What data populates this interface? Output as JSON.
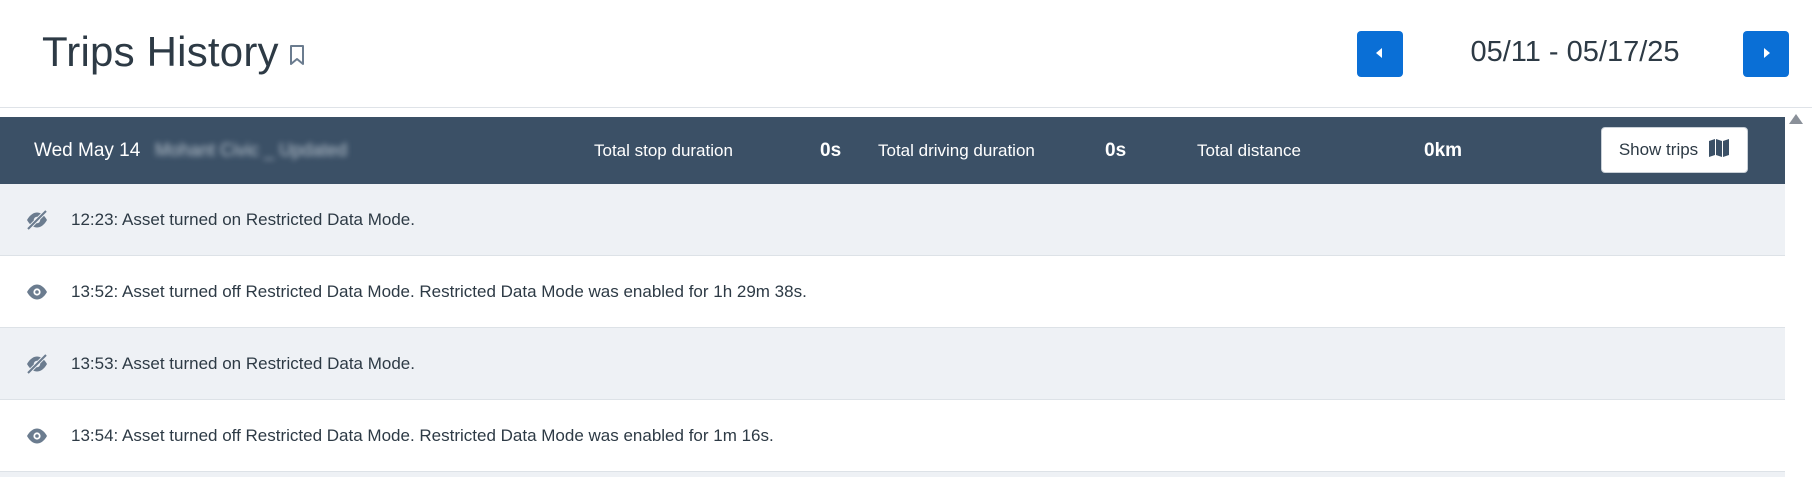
{
  "header": {
    "title": "Trips History",
    "date_range": "05/11 - 05/17/25",
    "icons": {
      "bookmark": "bookmark-icon",
      "prev": "chevron-left-icon",
      "next": "chevron-right-icon"
    }
  },
  "day": {
    "label": "Wed May 14",
    "asset_name": "Mohant Civic _ Updated",
    "stats": {
      "stop_label": "Total stop duration",
      "stop_value": "0s",
      "driving_label": "Total driving duration",
      "driving_value": "0s",
      "distance_label": "Total distance",
      "distance_value": "0km"
    },
    "show_trips_label": "Show trips",
    "show_trips_icon": "map-icon"
  },
  "events": [
    {
      "icon": "eye-slash-icon",
      "text": "12:23: Asset turned on Restricted Data Mode."
    },
    {
      "icon": "eye-icon",
      "text": "13:52: Asset turned off Restricted Data Mode. Restricted Data Mode was enabled for 1h 29m 38s."
    },
    {
      "icon": "eye-slash-icon",
      "text": "13:53: Asset turned on Restricted Data Mode."
    },
    {
      "icon": "eye-icon",
      "text": "13:54: Asset turned off Restricted Data Mode. Restricted Data Mode was enabled for 1m 16s."
    }
  ],
  "colors": {
    "accent": "#0a6fd6",
    "day_bar": "#3b5066",
    "row_shaded": "#eef1f5",
    "text": "#2d3a45"
  }
}
